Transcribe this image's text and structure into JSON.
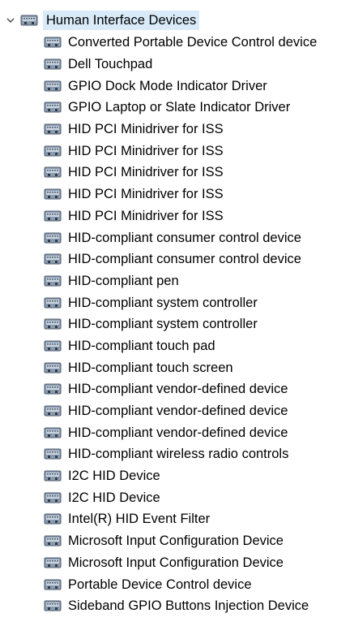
{
  "tree": {
    "group": {
      "label": "Human Interface Devices",
      "icon": "hid-device-icon",
      "expanded": true
    },
    "items": [
      {
        "label": "Converted Portable Device Control device",
        "icon": "hid-device-icon"
      },
      {
        "label": "Dell Touchpad",
        "icon": "hid-device-icon"
      },
      {
        "label": "GPIO Dock Mode Indicator Driver",
        "icon": "hid-device-icon"
      },
      {
        "label": "GPIO Laptop or Slate Indicator Driver",
        "icon": "hid-device-icon"
      },
      {
        "label": "HID PCI Minidriver for ISS",
        "icon": "hid-device-icon"
      },
      {
        "label": "HID PCI Minidriver for ISS",
        "icon": "hid-device-icon"
      },
      {
        "label": "HID PCI Minidriver for ISS",
        "icon": "hid-device-icon"
      },
      {
        "label": "HID PCI Minidriver for ISS",
        "icon": "hid-device-icon"
      },
      {
        "label": "HID PCI Minidriver for ISS",
        "icon": "hid-device-icon"
      },
      {
        "label": "HID-compliant consumer control device",
        "icon": "hid-device-icon"
      },
      {
        "label": "HID-compliant consumer control device",
        "icon": "hid-device-icon"
      },
      {
        "label": "HID-compliant pen",
        "icon": "hid-device-icon"
      },
      {
        "label": "HID-compliant system controller",
        "icon": "hid-device-icon"
      },
      {
        "label": "HID-compliant system controller",
        "icon": "hid-device-icon"
      },
      {
        "label": "HID-compliant touch pad",
        "icon": "hid-device-icon"
      },
      {
        "label": "HID-compliant touch screen",
        "icon": "hid-device-icon"
      },
      {
        "label": "HID-compliant vendor-defined device",
        "icon": "hid-device-icon"
      },
      {
        "label": "HID-compliant vendor-defined device",
        "icon": "hid-device-icon"
      },
      {
        "label": "HID-compliant vendor-defined device",
        "icon": "hid-device-icon"
      },
      {
        "label": "HID-compliant wireless radio controls",
        "icon": "hid-device-icon"
      },
      {
        "label": "I2C HID Device",
        "icon": "hid-device-icon"
      },
      {
        "label": "I2C HID Device",
        "icon": "hid-device-icon"
      },
      {
        "label": "Intel(R) HID Event Filter",
        "icon": "hid-device-icon"
      },
      {
        "label": "Microsoft Input Configuration Device",
        "icon": "hid-device-icon"
      },
      {
        "label": "Microsoft Input Configuration Device",
        "icon": "hid-device-icon"
      },
      {
        "label": "Portable Device Control device",
        "icon": "hid-device-icon"
      },
      {
        "label": "Sideband GPIO Buttons Injection Device",
        "icon": "hid-device-icon"
      }
    ],
    "colors": {
      "selection": "#d9ebf9",
      "text": "#000000"
    }
  }
}
